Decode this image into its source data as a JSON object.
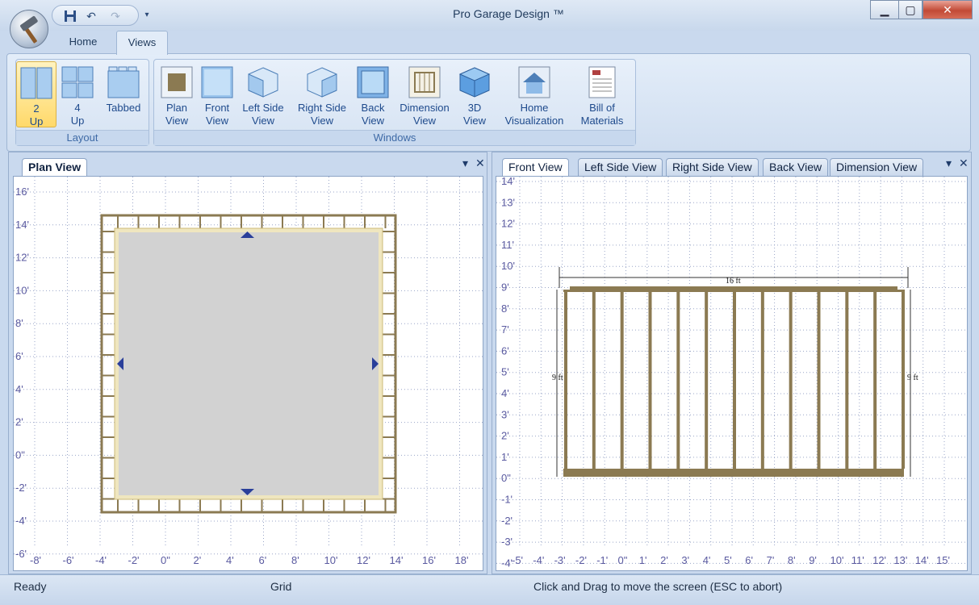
{
  "window": {
    "title": "Pro Garage Design ™",
    "controls": {
      "minimize": "▁",
      "maximize": "▢",
      "close": "✕"
    }
  },
  "quick_access": {
    "icons": [
      "save-icon",
      "undo-icon",
      "redo-icon",
      "customize-dropdown-icon"
    ]
  },
  "ribbon": {
    "tabs": [
      {
        "label": "Home"
      },
      {
        "label": "Views"
      }
    ],
    "active_tab": "Views",
    "groups": {
      "layout": {
        "label": "Layout",
        "buttons": [
          {
            "label": "2\nUp",
            "icon": "two-up-layout-icon",
            "active": true
          },
          {
            "label": "4\nUp",
            "icon": "four-up-layout-icon",
            "active": false
          },
          {
            "label": "Tabbed",
            "icon": "tabbed-layout-icon",
            "active": false
          }
        ]
      },
      "windows": {
        "label": "Windows",
        "buttons": [
          {
            "label": "Plan\nView",
            "icon": "plan-view-icon"
          },
          {
            "label": "Front\nView",
            "icon": "front-view-icon"
          },
          {
            "label": "Left Side\nView",
            "icon": "left-side-view-icon"
          },
          {
            "label": "Right Side\nView",
            "icon": "right-side-view-icon"
          },
          {
            "label": "Back\nView",
            "icon": "back-view-icon"
          },
          {
            "label": "Dimension\nView",
            "icon": "dimension-view-icon"
          },
          {
            "label": "3D\nView",
            "icon": "3d-view-icon"
          },
          {
            "label": "Home\nVisualization",
            "icon": "home-visualization-icon"
          },
          {
            "label": "Bill of\nMaterials",
            "icon": "bill-of-materials-icon"
          }
        ]
      }
    }
  },
  "left_pane": {
    "tabs": [
      {
        "label": "Plan View"
      }
    ],
    "active_tab": "Plan View",
    "y_labels": [
      "16'",
      "14'",
      "12'",
      "10'",
      "8'",
      "6'",
      "4'",
      "2'",
      "0\"",
      "-2'",
      "-4'",
      "-6'"
    ],
    "x_labels": [
      "-8'",
      "-6'",
      "-4'",
      "-2'",
      "0\"",
      "2'",
      "4'",
      "6'",
      "8'",
      "10'",
      "12'",
      "14'",
      "16'",
      "18'"
    ]
  },
  "right_pane": {
    "tabs": [
      {
        "label": "Front View"
      },
      {
        "label": "Left Side View"
      },
      {
        "label": "Right Side View"
      },
      {
        "label": "Back View"
      },
      {
        "label": "Dimension View"
      }
    ],
    "active_tab": "Front View",
    "y_labels": [
      "14'",
      "13'",
      "12'",
      "11'",
      "10'",
      "9'",
      "8'",
      "7'",
      "6'",
      "5'",
      "4'",
      "3'",
      "2'",
      "1'",
      "0\"",
      "-1'",
      "-2'",
      "-3'",
      "-4'"
    ],
    "x_labels": [
      "-5'",
      "-4'",
      "-3'",
      "-2'",
      "-1'",
      "0\"",
      "1'",
      "2'",
      "3'",
      "4'",
      "5'",
      "6'",
      "7'",
      "8'",
      "9'",
      "10'",
      "11'",
      "12'",
      "13'",
      "14'",
      "15'"
    ],
    "dimensions": {
      "width": "16 ft",
      "height_left": "9 ft",
      "height_right": "9 ft"
    }
  },
  "statusbar": {
    "ready": "Ready",
    "mode": "Grid",
    "hint": "Click and Drag to move the screen  (ESC to abort)"
  },
  "colors": {
    "framing": "#8b7a52",
    "floor": "#d2d2d2",
    "grid_text": "#5a5aa0",
    "handle": "#2a3f9a"
  }
}
